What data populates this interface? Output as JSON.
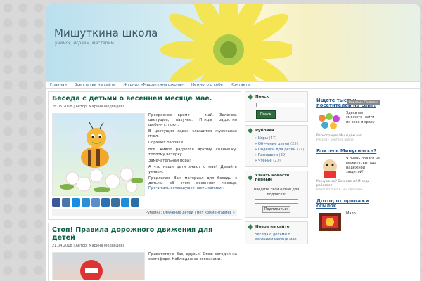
{
  "site": {
    "title": "Мишуткина школа",
    "tagline": "учимся, играем, мастерим..."
  },
  "nav": [
    "Главная",
    "Все статьи на сайте",
    "Журнал «Мишуткина школа»",
    "Немного о себе",
    "Контакты"
  ],
  "posts": [
    {
      "title": "Беседа с детьми о весеннем месяце мае.",
      "meta": "28.05.2018 | Автор: Марина Медведева",
      "paragraphs": [
        "Прекрасное время — май. Зеленое, цветущее, пахучее. Птицы радостно щебечут, поют.",
        "В цветущих садах слышится жужжание пчел.",
        "Порхают бабочки.",
        "Все живое радуется яркому солнышку, теплому ветерку.",
        "Замечательная пора!",
        "А что наши дети знают о мае? Давайте узнаем.",
        "Предлагаю Вам материал для беседы с детьми об этом весеннем месяце."
      ],
      "more": "Прочитать оставшуюся часть записи »",
      "rubric_label": "Рубрика:",
      "rubric": "Обучение детей",
      "comments": "Нет комментариев »"
    },
    {
      "title": "Стоп! Правила дорожного движения для детей",
      "meta": "21.04.2018 | Автор: Марина Медведева",
      "paragraphs": [
        "Приветствую Вас, друзья! Стою сегодня на светофоре. Наблюдаю за огоньками."
      ]
    }
  ],
  "sidebar": {
    "search_title": "Поиск",
    "search_button": "Поиск",
    "rubrics_title": "Рубрики",
    "rubrics": [
      {
        "name": "Игры",
        "count": "(47)"
      },
      {
        "name": "Обучение детей",
        "count": "(25)"
      },
      {
        "name": "Поделки для детей",
        "count": "(21)"
      },
      {
        "name": "Раскраски",
        "count": "(39)"
      },
      {
        "name": "Чтение",
        "count": "(27)"
      }
    ],
    "subscribe_title": "Узнать новости первым",
    "subscribe_text": "Введите свой e-mail для подписки:",
    "subscribe_button": "Подписаться",
    "news_title": "Новое на сайте",
    "news": [
      "Беседа с детьми о",
      "весеннем месяце мае."
    ]
  },
  "ads": {
    "label": "Реклама Contento",
    "items": [
      {
        "title": "Ищете тысячу посетителей на сайт?",
        "text": "Здесь вы сможете найти их всех и сразу",
        "note": "Регистрация   Мы ждём вас",
        "url": "Россия - контент.online"
      },
      {
        "title": "Боитесь Минусинска?",
        "text": "Я очень боялся не выжить, вы под надежной защитой!",
        "note": "Минусинск?   Безопасно!   И ведь работает!",
        "url": "8 800 00 00 00 · мы сделаем"
      },
      {
        "title": "Доход от продажи ссылок",
        "text": "Мало",
        "note": "",
        "url": ""
      }
    ]
  },
  "colors": {
    "post_title": "#0c5c46",
    "link": "#2a5f93",
    "button": "#2d6d3e"
  }
}
